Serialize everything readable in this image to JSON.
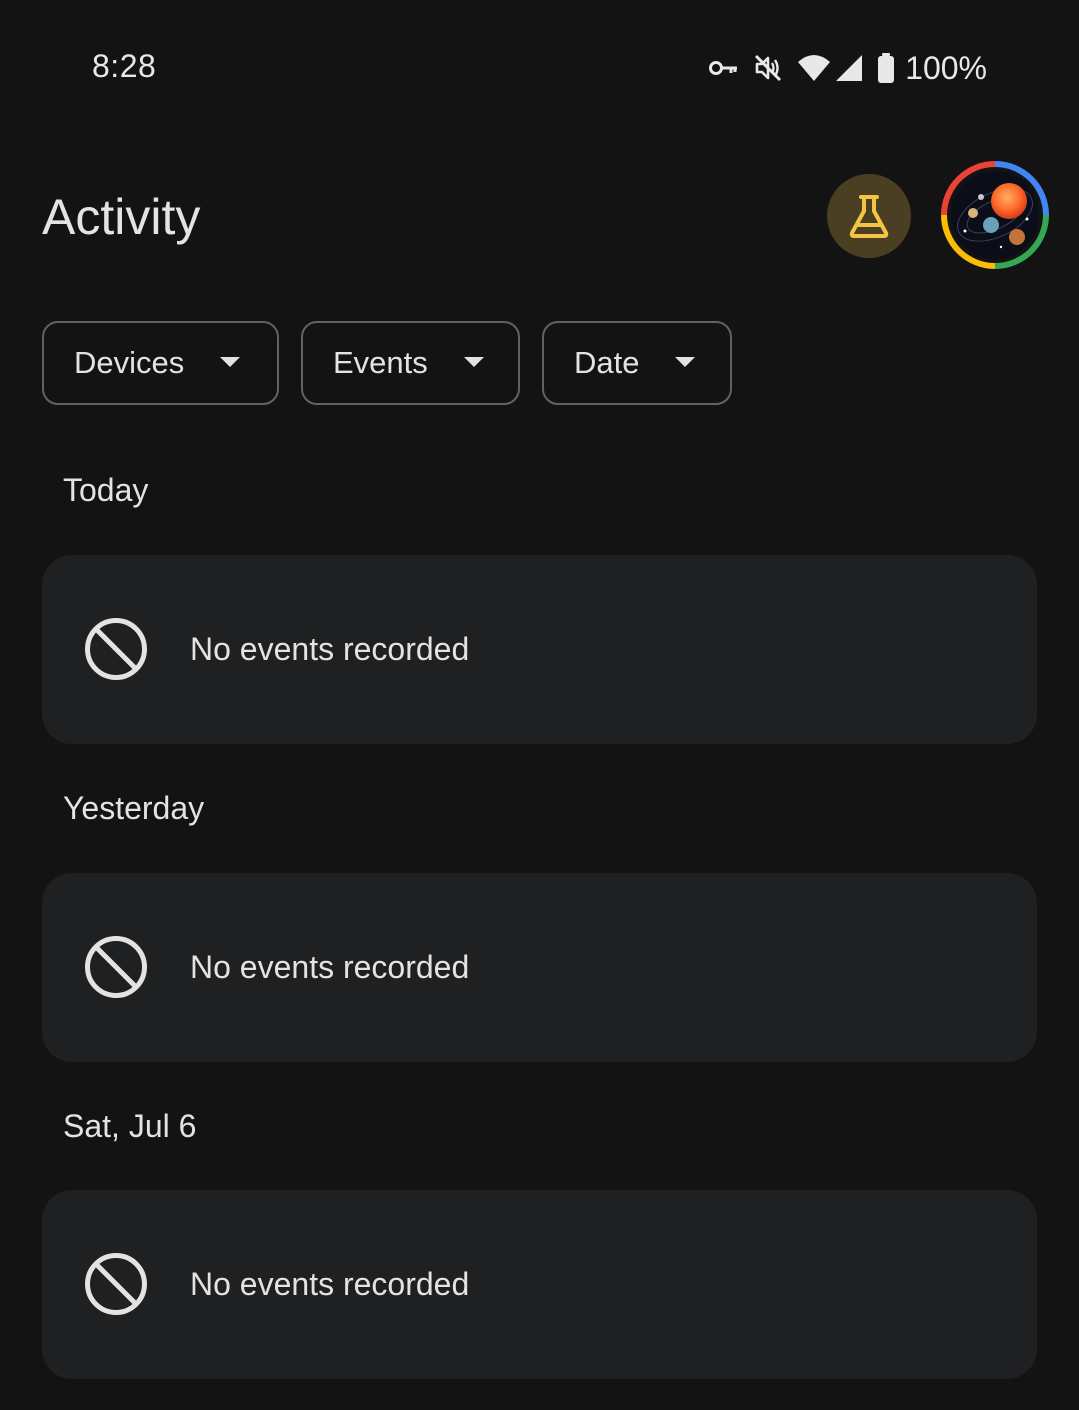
{
  "status_bar": {
    "time": "8:28",
    "battery": "100%",
    "icons": [
      "vpn-key-icon",
      "sound-off-icon",
      "wifi-icon",
      "cell-signal-icon",
      "battery-icon"
    ]
  },
  "header": {
    "title": "Activity",
    "labs_icon": "flask-icon",
    "avatar_icon": "avatar"
  },
  "filters": [
    {
      "label": "Devices",
      "icon": "dropdown-arrow-icon"
    },
    {
      "label": "Events",
      "icon": "dropdown-arrow-icon"
    },
    {
      "label": "Date",
      "icon": "dropdown-arrow-icon"
    }
  ],
  "sections": [
    {
      "label": "Today",
      "message": "No events recorded",
      "icon": "block-icon"
    },
    {
      "label": "Yesterday",
      "message": "No events recorded",
      "icon": "block-icon"
    },
    {
      "label": "Sat, Jul 6",
      "message": "No events recorded",
      "icon": "block-icon"
    }
  ],
  "colors": {
    "background": "#131314",
    "card": "#1f2022",
    "labs_bg": "#4a3f22",
    "labs_icon": "#f4c542",
    "chip_border": "#5f6368"
  }
}
